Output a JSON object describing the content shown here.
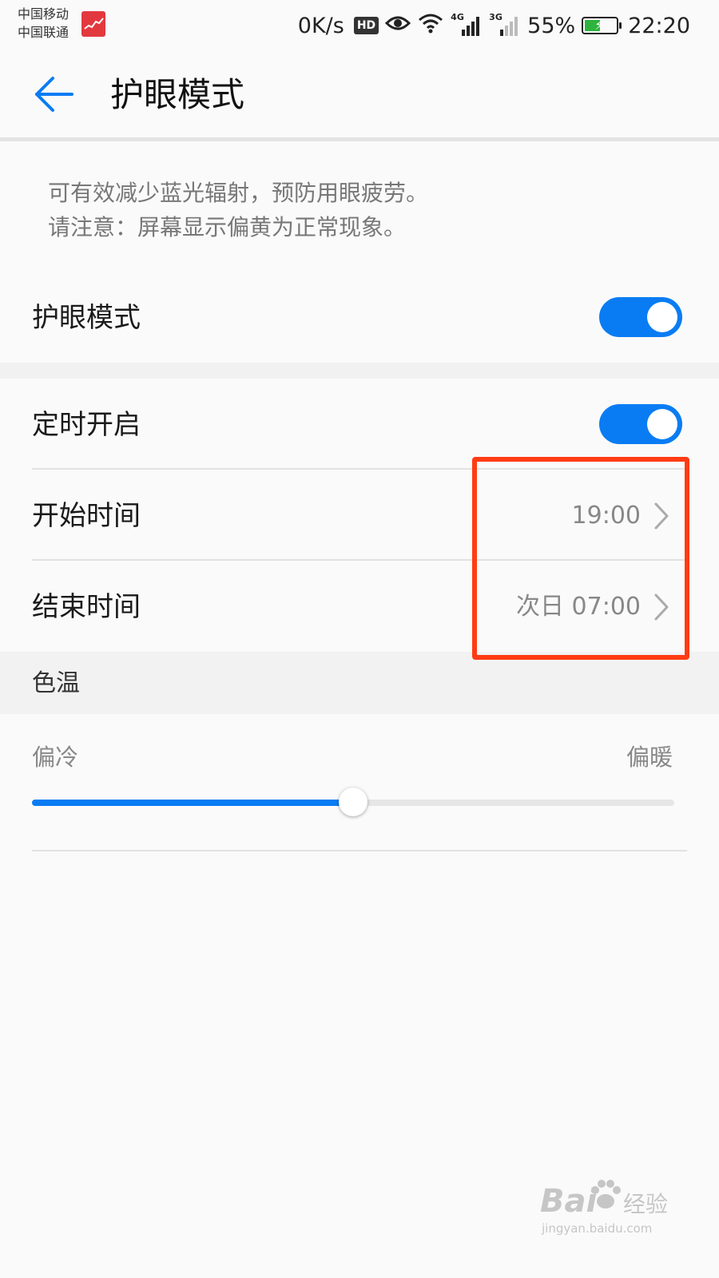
{
  "status_bar": {
    "carrier_1": "中国移动",
    "carrier_2": "中国联通",
    "net_speed": "0K/s",
    "hd_label": "HD",
    "net_type_1": "4G",
    "net_type_2": "3G",
    "battery_percent": "55%",
    "battery_level": 0.55,
    "time": "22:20",
    "icons": [
      "eye-icon",
      "wifi-icon",
      "signal-icon",
      "battery-charging-icon"
    ]
  },
  "header": {
    "back_icon": "arrow-left-icon",
    "title": "护眼模式"
  },
  "description": {
    "line_1": "可有效减少蓝光辐射，预防用眼疲劳。",
    "line_2": "请注意：屏幕显示偏黄为正常现象。"
  },
  "eye_comfort": {
    "label": "护眼模式",
    "enabled": true
  },
  "schedule": {
    "label": "定时开启",
    "enabled": true,
    "start": {
      "label": "开始时间",
      "value": "19:00"
    },
    "end": {
      "label": "结束时间",
      "value": "次日 07:00"
    }
  },
  "color_temperature": {
    "title": "色温",
    "cool_label": "偏冷",
    "warm_label": "偏暖",
    "value_fraction": 0.5
  },
  "colors": {
    "accent": "#0a7cf3",
    "highlight": "#ff3c14"
  },
  "watermark": {
    "brand": "Bai",
    "brand_suffix": "经验",
    "url": "jingyan.baidu.com"
  }
}
